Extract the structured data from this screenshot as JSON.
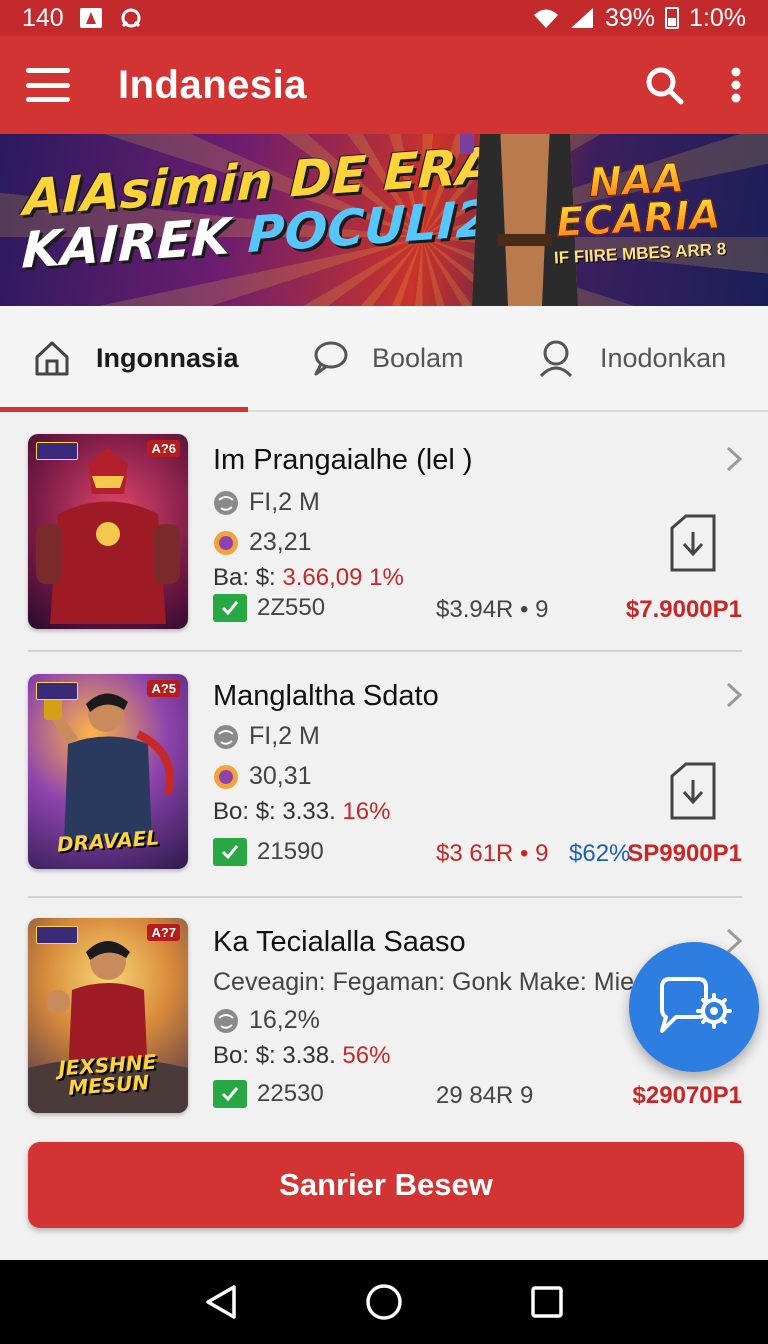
{
  "status_bar": {
    "time_left": "140",
    "battery": "39%",
    "clock": "1:0%"
  },
  "app_bar": {
    "title": "Indanesia",
    "icons": [
      "menu-icon",
      "search-icon",
      "more-vert-icon"
    ]
  },
  "banner": {
    "headline_part1": "AIAsimin DE ERAN",
    "headline_part2_white": "KAIREK ",
    "headline_part2_blue": "POCULI2!!",
    "badge_title_line1": "NAA",
    "badge_title_line2": "ECARIA",
    "badge_sub": "IF FIIRE MBES ARR 8"
  },
  "tabs": [
    {
      "label": "Ingonnasia",
      "icon": "home-icon",
      "active": true
    },
    {
      "label": "Boolam",
      "icon": "chat-bubble-icon",
      "active": false
    },
    {
      "label": "Inodonkan",
      "icon": "search-icon",
      "active": false
    }
  ],
  "cards": [
    {
      "title": "Im Prangaialhe (lel )",
      "meta1": "FI,2  M",
      "meta2": "23,21",
      "price_prefix": "Ba: $: ",
      "price_pct": "3.66,09 1%",
      "chip_value": "2Z550",
      "mid_value": "$3.94R • 9",
      "mid_value2": "",
      "right_price": "$7.9000P1",
      "thumb_logo": "",
      "age_badge": "A?6"
    },
    {
      "title": "Manglaltha Sdato",
      "meta1": "FI,2  M",
      "meta2": "30,31",
      "price_prefix": "Bo: $: 3.33. ",
      "price_pct": "16%",
      "chip_value": "21590",
      "mid_value": "$3 61R • 9",
      "mid_value2": "$62%",
      "right_price": "SP9900P1",
      "thumb_logo": "DRAVAEL",
      "age_badge": "A?5"
    },
    {
      "title": "Ka Tecialalla Saaso",
      "subtitle": "Ceveagin: Fegaman: Gonk Make: Mie",
      "meta1": "16,2%",
      "price_prefix": "Bo: $: 3.38. ",
      "price_pct": "56%",
      "chip_value": "22530",
      "mid_value": "29 84R  9",
      "right_price": "$29070P1",
      "thumb_logo": "JEXSHNE MESUN",
      "age_badge": "A?7"
    }
  ],
  "primary_button": {
    "label": "Sanrier Besew"
  },
  "fab": {
    "icon": "chat-settings-icon"
  },
  "nav_bar": {
    "icons": [
      "back-icon",
      "home-circle-icon",
      "recents-icon"
    ]
  },
  "colors": {
    "primary": "#d23333",
    "status_bar": "#c32a2c",
    "fab": "#2e7de0",
    "chip_green": "#28a745",
    "price_red": "#c62828",
    "price_blue": "#1e5fb8"
  }
}
